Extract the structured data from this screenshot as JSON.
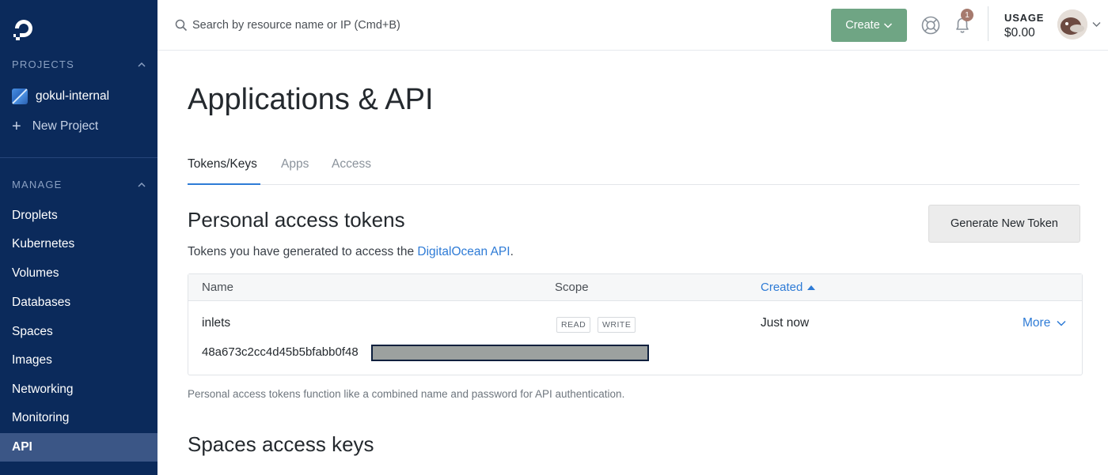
{
  "sidebar": {
    "projects_heading": "PROJECTS",
    "project_name": "gokul-internal",
    "new_project_label": "New Project",
    "manage_heading": "MANAGE",
    "nav_items": [
      {
        "label": "Droplets"
      },
      {
        "label": "Kubernetes"
      },
      {
        "label": "Volumes"
      },
      {
        "label": "Databases"
      },
      {
        "label": "Spaces"
      },
      {
        "label": "Images"
      },
      {
        "label": "Networking"
      },
      {
        "label": "Monitoring"
      },
      {
        "label": "API",
        "active": true
      }
    ]
  },
  "topbar": {
    "search_placeholder": "Search by resource name or IP (Cmd+B)",
    "create_label": "Create",
    "notifications_count": "1",
    "usage_label": "USAGE",
    "usage_value": "$0.00"
  },
  "page": {
    "title": "Applications & API",
    "tabs": [
      {
        "label": "Tokens/Keys",
        "active": true
      },
      {
        "label": "Apps"
      },
      {
        "label": "Access"
      }
    ]
  },
  "personal_tokens": {
    "heading": "Personal access tokens",
    "generate_label": "Generate New Token",
    "description_prefix": "Tokens you have generated to access the ",
    "description_link": "DigitalOcean API",
    "description_suffix": ".",
    "columns": {
      "name": "Name",
      "scope": "Scope",
      "created": "Created"
    },
    "rows": [
      {
        "name": "inlets",
        "scopes": [
          "READ",
          "WRITE"
        ],
        "created": "Just now",
        "more_label": "More",
        "token_visible": "48a673c2cc4d45b5bfabb0f48"
      }
    ],
    "footnote": "Personal access tokens function like a combined name and password for API authentication."
  },
  "spaces_keys": {
    "heading": "Spaces access keys"
  },
  "colors": {
    "sidebar_bg": "#0b2a5b",
    "sidebar_active": "#3b5686",
    "create_button": "#6fa584",
    "link_blue": "#2e7bd6"
  }
}
